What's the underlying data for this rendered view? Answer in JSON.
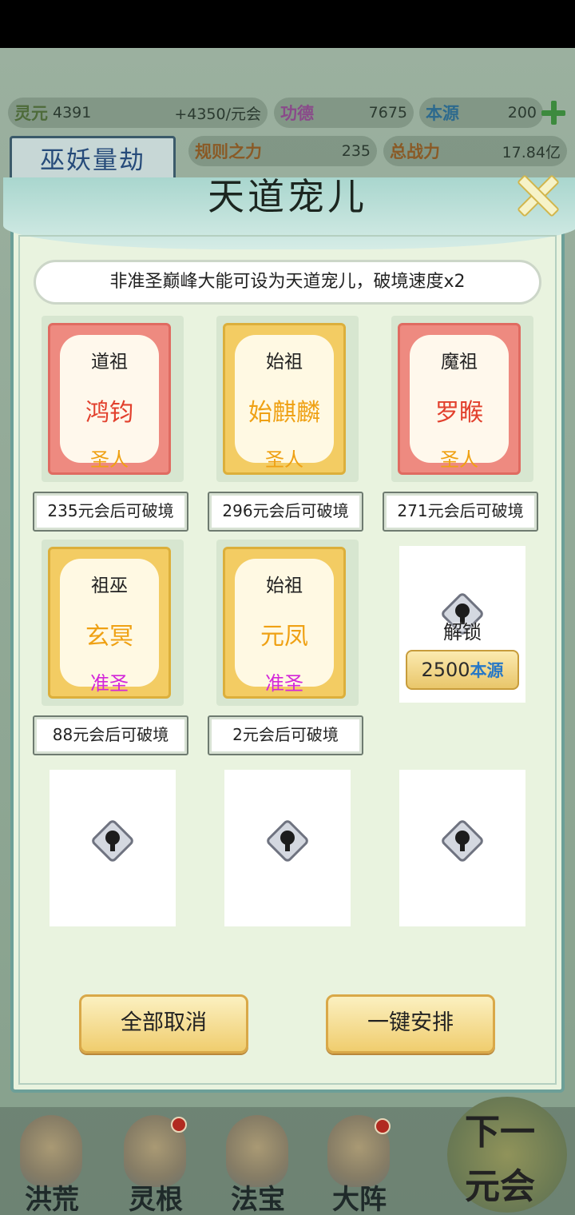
{
  "top_resources": {
    "lingyuan_label": "灵元",
    "lingyuan_value": "4391",
    "lingyuan_rate": "+4350/元会",
    "gongde_label": "功德",
    "gongde_value": "7675",
    "benyuan_label": "本源",
    "benyuan_value": "200",
    "guize_label": "规则之力",
    "guize_value": "235",
    "zhanli_label": "总战力",
    "zhanli_value": "17.84亿"
  },
  "event_banner": "巫妖量劫",
  "modal": {
    "title": "天道宠儿",
    "info": "非准圣巅峰大能可设为天道宠儿，破境速度x2",
    "cards": [
      {
        "title": "道祖",
        "name": "鸿钧",
        "rank": "圣人",
        "rank_color": "#efa114",
        "style": "red",
        "status": "235元会后可破境"
      },
      {
        "title": "始祖",
        "name": "始麒麟",
        "rank": "圣人",
        "rank_color": "#efa114",
        "style": "gold",
        "status": "296元会后可破境"
      },
      {
        "title": "魔祖",
        "name": "罗睺",
        "rank": "圣人",
        "rank_color": "#efa114",
        "style": "red",
        "status": "271元会后可破境"
      },
      {
        "title": "祖巫",
        "name": "玄冥",
        "rank": "准圣",
        "rank_color": "#d327d9",
        "style": "gold",
        "status": "88元会后可破境"
      },
      {
        "title": "始祖",
        "name": "元凤",
        "rank": "准圣",
        "rank_color": "#d327d9",
        "style": "gold",
        "status": "2元会后可破境"
      }
    ],
    "unlock_slot": {
      "label": "解锁",
      "cost": "2500",
      "cost_unit": "本源"
    },
    "cancel_all_label": "全部取消",
    "auto_arrange_label": "一键安排"
  },
  "bottom_nav": {
    "items": [
      "洪荒",
      "灵根",
      "法宝",
      "大阵"
    ],
    "next_line1": "下一",
    "next_line2": "元会"
  },
  "icons": [
    "plus-icon",
    "close-icon",
    "lock-icon"
  ]
}
